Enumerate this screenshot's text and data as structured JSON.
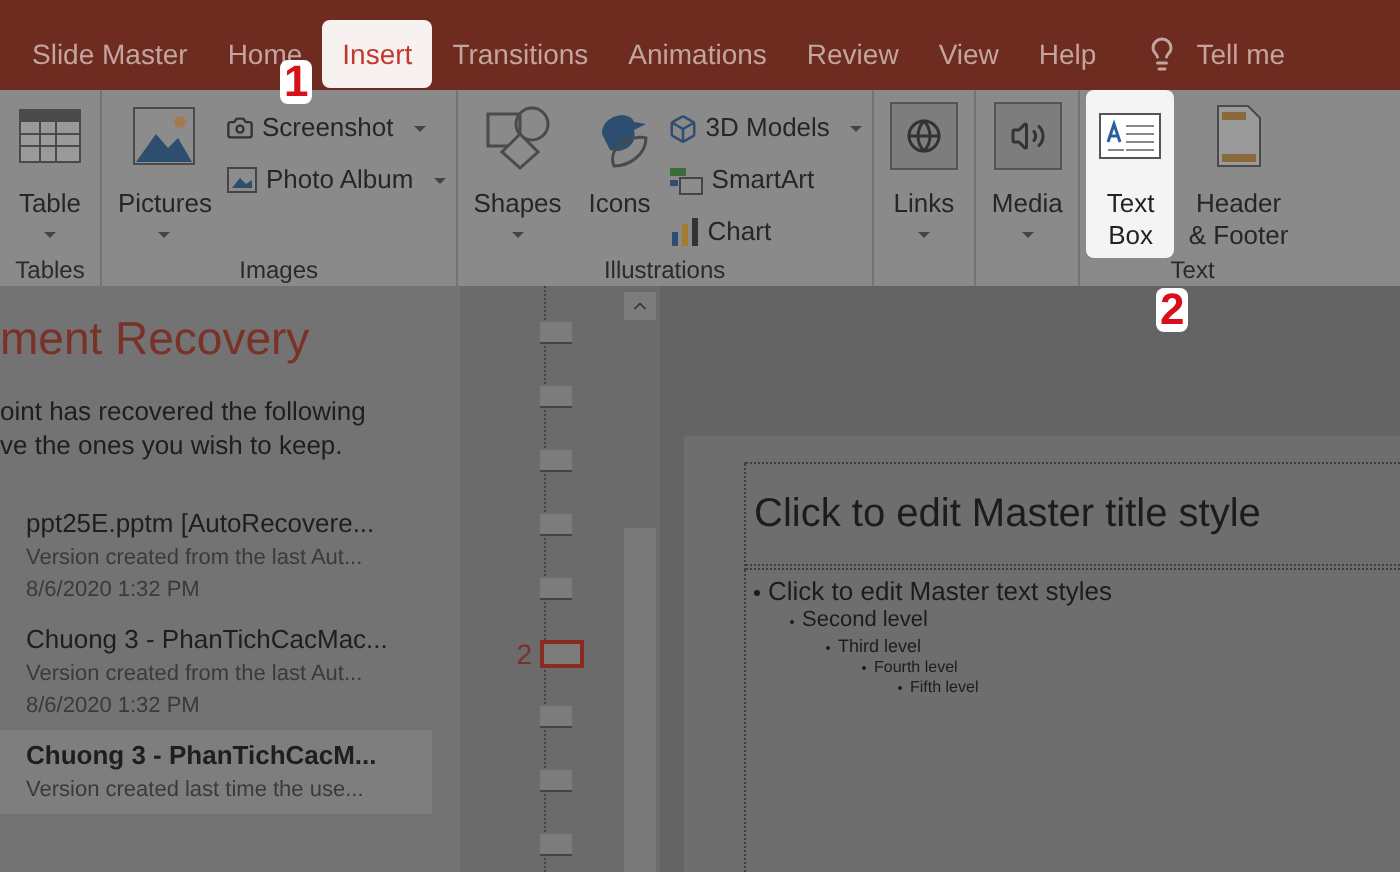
{
  "tabs": [
    {
      "label": "Slide Master",
      "selected": false
    },
    {
      "label": "Home",
      "selected": false
    },
    {
      "label": "Insert",
      "selected": true
    },
    {
      "label": "Transitions",
      "selected": false
    },
    {
      "label": "Animations",
      "selected": false
    },
    {
      "label": "Review",
      "selected": false
    },
    {
      "label": "View",
      "selected": false
    },
    {
      "label": "Help",
      "selected": false
    }
  ],
  "tell_me": "Tell me",
  "ribbon": {
    "groups": [
      {
        "label": "Tables",
        "columns": [
          [
            {
              "kind": "large",
              "label": [
                "Table"
              ],
              "dropdown": true,
              "highlighted": false
            }
          ]
        ]
      },
      {
        "label": "Images",
        "columns": [
          [
            {
              "kind": "large",
              "label": [
                "Pictures"
              ],
              "dropdown": true,
              "highlighted": false
            }
          ],
          [
            {
              "kind": "small",
              "label": "Screenshot",
              "dropdown": true
            },
            {
              "kind": "small",
              "label": "Photo Album",
              "dropdown": true
            }
          ]
        ]
      },
      {
        "label": "Illustrations",
        "columns": [
          [
            {
              "kind": "large",
              "label": [
                "Shapes"
              ],
              "dropdown": true,
              "highlighted": false
            }
          ],
          [
            {
              "kind": "large",
              "label": [
                "Icons"
              ],
              "dropdown": false,
              "highlighted": false
            }
          ],
          [
            {
              "kind": "small",
              "label": "3D Models",
              "dropdown": true
            },
            {
              "kind": "small",
              "label": "SmartArt",
              "dropdown": false
            },
            {
              "kind": "small",
              "label": "Chart",
              "dropdown": false
            }
          ]
        ]
      },
      {
        "columns": [
          [
            {
              "kind": "large",
              "label": [
                "Links"
              ],
              "dropdown": true,
              "highlighted": false
            }
          ]
        ]
      },
      {
        "columns": [
          [
            {
              "kind": "large",
              "label": [
                "Media"
              ],
              "dropdown": true,
              "highlighted": false
            }
          ]
        ]
      },
      {
        "label": "Text",
        "columns": [
          [
            {
              "kind": "large",
              "label": [
                "Text",
                "Box"
              ],
              "dropdown": false,
              "highlighted": true
            }
          ],
          [
            {
              "kind": "large",
              "label": [
                "Header",
                "& Footer"
              ],
              "dropdown": false,
              "highlighted": false
            }
          ]
        ]
      }
    ]
  },
  "recovery": {
    "title": "ment Recovery",
    "message": [
      "oint has recovered the following",
      "ve the ones you wish to keep."
    ],
    "files": [
      {
        "title": "ppt25E.pptm  [AutoRecovere...",
        "description": "Version created from the last Aut...",
        "date": "8/6/2020 1:32 PM",
        "selected": false
      },
      {
        "title": "Chuong 3 - PhanTichCacMac...",
        "description": "Version created from the last Aut...",
        "date": "8/6/2020 1:32 PM",
        "selected": false
      },
      {
        "title": "Chuong 3 - PhanTichCacM...",
        "description": "Version created last time the use...",
        "selected": true
      }
    ]
  },
  "thumbnails": [
    {
      "selected": false
    },
    {
      "selected": false
    },
    {
      "selected": false
    },
    {
      "selected": false
    },
    {
      "selected": false
    },
    {
      "selected": true,
      "number": "2"
    },
    {
      "selected": false
    },
    {
      "selected": false
    },
    {
      "selected": false
    }
  ],
  "slide": {
    "title": "Click to edit Master title style",
    "body": [
      {
        "text": "Click to edit Master text styles",
        "children": [
          {
            "text": "Second level",
            "children": [
              {
                "text": "Third level",
                "children": [
                  {
                    "text": "Fourth level",
                    "children": [
                      {
                        "text": "Fifth level"
                      }
                    ]
                  }
                ]
              }
            ]
          }
        ]
      }
    ]
  },
  "annotations": [
    {
      "text": "1"
    },
    {
      "text": "2"
    }
  ]
}
